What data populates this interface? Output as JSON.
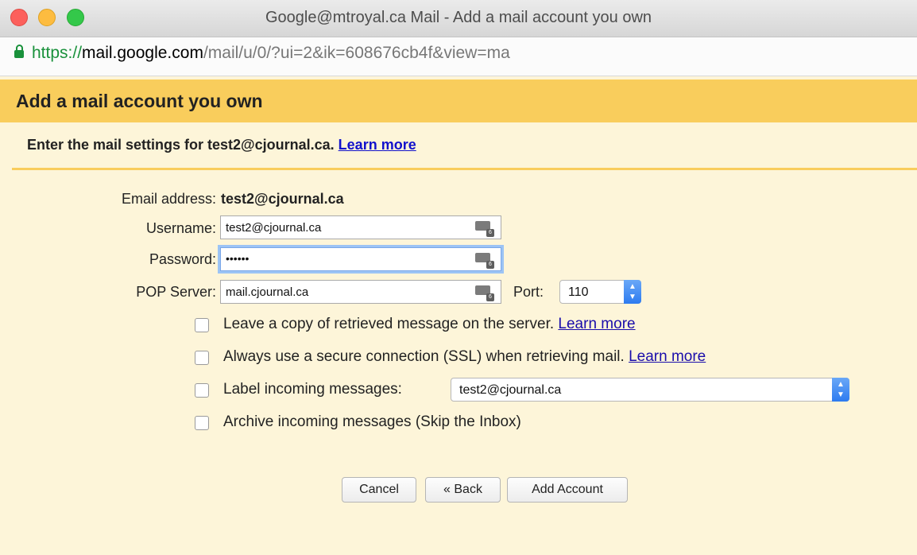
{
  "window": {
    "title": "Google@mtroyal.ca Mail - Add a mail account you own"
  },
  "addressbar": {
    "scheme": "https://",
    "host": "mail.google.com",
    "path": "/mail/u/0/?ui=2&ik=608676cb4f&view=ma"
  },
  "dialog": {
    "title": "Add a mail account you own",
    "instructions": "Enter the mail settings for test2@cjournal.ca.",
    "learn_more": "Learn more"
  },
  "form": {
    "email_label": "Email address:",
    "email_value": "test2@cjournal.ca",
    "username_label": "Username:",
    "username_value": "test2@cjournal.ca",
    "password_label": "Password:",
    "password_value": "••••••",
    "pop_label": "POP Server:",
    "pop_value": "mail.cjournal.ca",
    "port_label": "Port:",
    "port_value": "110"
  },
  "options": {
    "leave_copy": "Leave a copy of retrieved message on the server.",
    "leave_copy_link": "Learn more",
    "ssl": "Always use a secure connection (SSL) when retrieving mail.",
    "ssl_link": "Learn more",
    "label_incoming": "Label incoming messages:",
    "label_value": "test2@cjournal.ca",
    "archive": "Archive incoming messages (Skip the Inbox)"
  },
  "buttons": {
    "cancel": "Cancel",
    "back": "« Back",
    "add": "Add Account"
  },
  "colors": {
    "header_band": "#f9cd5c",
    "page_bg": "#fdf5d9",
    "link": "#1a0dab"
  }
}
